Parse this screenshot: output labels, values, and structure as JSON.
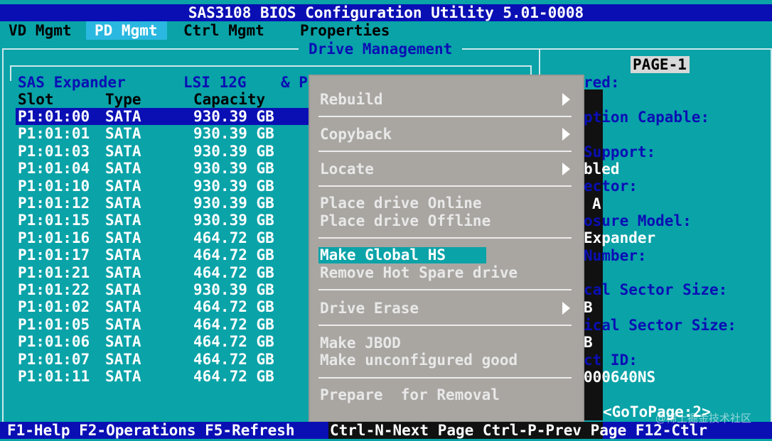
{
  "title": "SAS3108 BIOS Configuration Utility 5.01-0008",
  "tabs": [
    "VD Mgmt",
    "PD Mgmt",
    "Ctrl Mgmt",
    "Properties"
  ],
  "active_tab": "PD Mgmt",
  "section_title": "Drive Management",
  "drive_list": {
    "header_left": "SAS Expander",
    "header_mid": "LSI 12G",
    "header_right": "& P",
    "columns": [
      "Slot",
      "Type",
      "Capacity"
    ],
    "rows": [
      {
        "slot": "P1:01:00",
        "type": "SATA",
        "capacity": "930.39 GB"
      },
      {
        "slot": "P1:01:01",
        "type": "SATA",
        "capacity": "930.39 GB"
      },
      {
        "slot": "P1:01:03",
        "type": "SATA",
        "capacity": "930.39 GB"
      },
      {
        "slot": "P1:01:04",
        "type": "SATA",
        "capacity": "930.39 GB"
      },
      {
        "slot": "P1:01:10",
        "type": "SATA",
        "capacity": "930.39 GB"
      },
      {
        "slot": "P1:01:12",
        "type": "SATA",
        "capacity": "930.39 GB"
      },
      {
        "slot": "P1:01:15",
        "type": "SATA",
        "capacity": "930.39 GB"
      },
      {
        "slot": "P1:01:16",
        "type": "SATA",
        "capacity": "464.72 GB"
      },
      {
        "slot": "P1:01:17",
        "type": "SATA",
        "capacity": "464.72 GB"
      },
      {
        "slot": "P1:01:21",
        "type": "SATA",
        "capacity": "464.72 GB"
      },
      {
        "slot": "P1:01:22",
        "type": "SATA",
        "capacity": "930.39 GB"
      },
      {
        "slot": "P1:01:02",
        "type": "SATA",
        "capacity": "464.72 GB"
      },
      {
        "slot": "P1:01:05",
        "type": "SATA",
        "capacity": "464.72 GB"
      },
      {
        "slot": "P1:01:06",
        "type": "SATA",
        "capacity": "464.72 GB"
      },
      {
        "slot": "P1:01:07",
        "type": "SATA",
        "capacity": "464.72 GB"
      },
      {
        "slot": "P1:01:11",
        "type": "SATA",
        "capacity": "464.72 GB"
      }
    ],
    "selected_row": "P1:01:00"
  },
  "right_panel": {
    "page_label": "PAGE-1",
    "lines": [
      "red:",
      "ption Capable:",
      "Support:",
      "bled",
      "ector:",
      "A",
      "osure Model:",
      "Expander",
      "Number:",
      "cal Sector Size:",
      "B",
      "ical Sector Size:",
      "B",
      "ct ID:",
      "000640NS"
    ],
    "goto": "<GoToPage:2>"
  },
  "context_menu": {
    "items": [
      "Rebuild",
      "Copyback",
      "Locate",
      "Place drive Online",
      "Place drive Offline",
      "Make Global HS",
      "Remove Hot Spare drive",
      "Drive Erase",
      "Make JBOD",
      "Make unconfigured good",
      "Prepare  for Removal"
    ],
    "selected": "Make Global HS",
    "submenu_items": [
      "Rebuild",
      "Copyback",
      "Locate",
      "Drive Erase"
    ]
  },
  "status_bar": {
    "left": "F1-Help F2-Operations F5-Refresh",
    "right": "Ctrl-N-Next Page Ctrl-P-Prev Page F12-Ctlr"
  },
  "watermark": "@稀土掘金技术社区",
  "colors": {
    "background": "#0aa3a8",
    "title_blue": "#0a0fb4",
    "menu_gray": "#a9a6a2"
  }
}
